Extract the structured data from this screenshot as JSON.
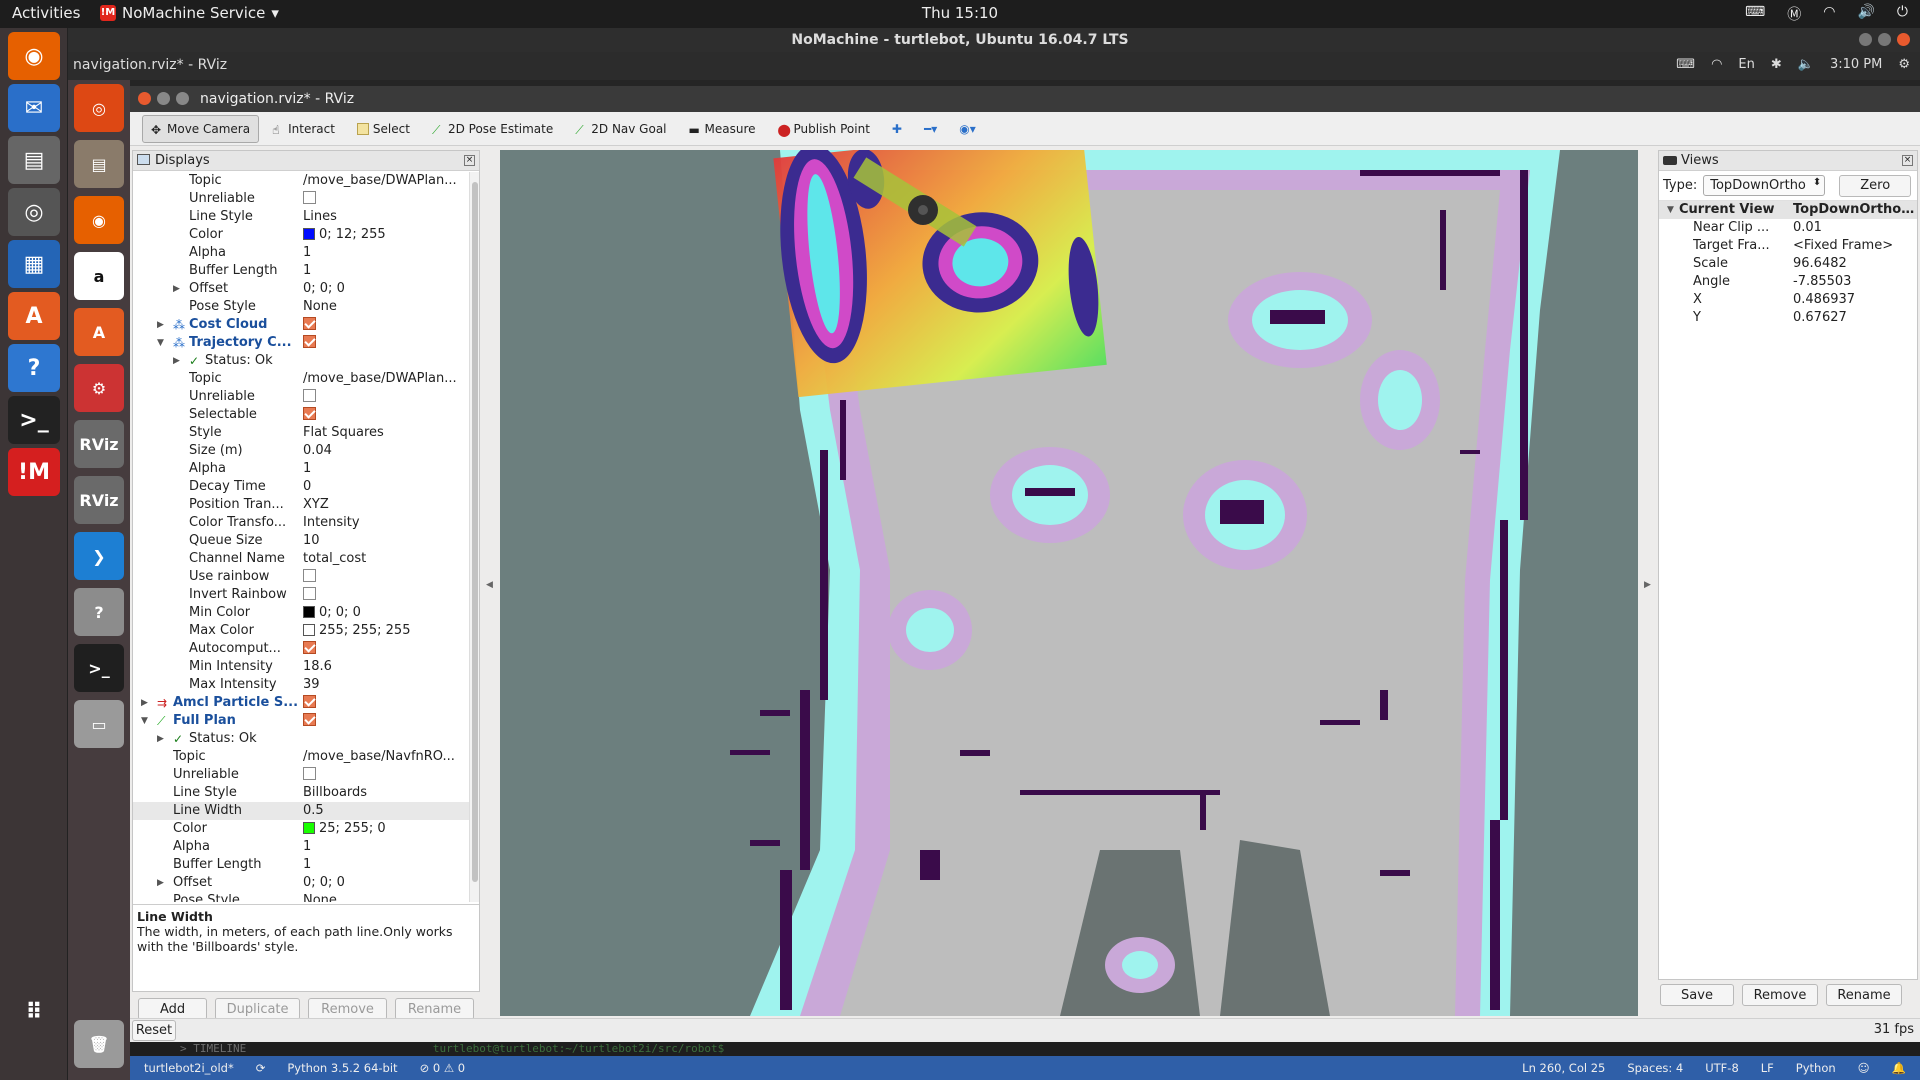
{
  "topbar": {
    "activities": "Activities",
    "app": "NoMachine Service",
    "clock": "Thu 15:10"
  },
  "nomachine_title": "NoMachine - turtlebot, Ubuntu 16.04.7 LTS",
  "inner_bar": {
    "title": "navigation.rviz* - RViz",
    "lang": "En",
    "time": "3:10 PM"
  },
  "rviz": {
    "title": "navigation.rviz* - RViz",
    "toolbar": [
      {
        "label": "Move Camera",
        "icon": "move-camera-icon"
      },
      {
        "label": "Interact",
        "icon": "interact-icon"
      },
      {
        "label": "Select",
        "icon": "select-icon"
      },
      {
        "label": "2D Pose Estimate",
        "icon": "pose-estimate-icon"
      },
      {
        "label": "2D Nav Goal",
        "icon": "nav-goal-icon"
      },
      {
        "label": "Measure",
        "icon": "measure-icon"
      },
      {
        "label": "Publish Point",
        "icon": "publish-point-icon"
      }
    ],
    "displays": {
      "title": "Displays",
      "rows": [
        {
          "key": "Topic",
          "value": "/move_base/DWAPlan...",
          "indent": 2
        },
        {
          "key": "Unreliable",
          "check": false,
          "indent": 2
        },
        {
          "key": "Line Style",
          "value": "Lines",
          "indent": 2
        },
        {
          "key": "Color",
          "value": "0; 12; 255",
          "swatch": "#000cff",
          "indent": 2
        },
        {
          "key": "Alpha",
          "value": "1",
          "indent": 2
        },
        {
          "key": "Buffer Length",
          "value": "1",
          "indent": 2
        },
        {
          "key": "Offset",
          "value": "0; 0; 0",
          "indent": 2,
          "arrow": "▶"
        },
        {
          "key": "Pose Style",
          "value": "None",
          "indent": 2
        },
        {
          "key": "Cost Cloud",
          "check": true,
          "indent": 1,
          "arrow": "▶",
          "group": true,
          "icon": "cloud"
        },
        {
          "key": "Trajectory C...",
          "check": true,
          "indent": 1,
          "arrow": "▼",
          "group": true,
          "icon": "cloud"
        },
        {
          "key": "Status: Ok",
          "indent": 2,
          "arrow": "▶",
          "status": true
        },
        {
          "key": "Topic",
          "value": "/move_base/DWAPlan...",
          "indent": 2
        },
        {
          "key": "Unreliable",
          "check": false,
          "indent": 2
        },
        {
          "key": "Selectable",
          "check": true,
          "indent": 2
        },
        {
          "key": "Style",
          "value": "Flat Squares",
          "indent": 2
        },
        {
          "key": "Size (m)",
          "value": "0.04",
          "indent": 2
        },
        {
          "key": "Alpha",
          "value": "1",
          "indent": 2
        },
        {
          "key": "Decay Time",
          "value": "0",
          "indent": 2
        },
        {
          "key": "Position Tran...",
          "value": "XYZ",
          "indent": 2
        },
        {
          "key": "Color Transfo...",
          "value": "Intensity",
          "indent": 2
        },
        {
          "key": "Queue Size",
          "value": "10",
          "indent": 2
        },
        {
          "key": "Channel Name",
          "value": "total_cost",
          "indent": 2
        },
        {
          "key": "Use rainbow",
          "check": false,
          "indent": 2
        },
        {
          "key": "Invert Rainbow",
          "check": false,
          "indent": 2
        },
        {
          "key": "Min Color",
          "value": "0; 0; 0",
          "swatch": "#000000",
          "indent": 2
        },
        {
          "key": "Max Color",
          "value": "255; 255; 255",
          "swatch": "#ffffff",
          "indent": 2
        },
        {
          "key": "Autocomput...",
          "check": true,
          "indent": 2
        },
        {
          "key": "Min Intensity",
          "value": "18.6",
          "indent": 2
        },
        {
          "key": "Max Intensity",
          "value": "39",
          "indent": 2
        },
        {
          "key": "Amcl Particle S...",
          "check": true,
          "indent": 0,
          "arrow": "▶",
          "group": true,
          "icon": "arrows"
        },
        {
          "key": "Full Plan",
          "check": true,
          "indent": 0,
          "arrow": "▼",
          "group": true,
          "icon": "path"
        },
        {
          "key": "Status: Ok",
          "indent": 1,
          "arrow": "▶",
          "status": true
        },
        {
          "key": "Topic",
          "value": "/move_base/NavfnRO...",
          "indent": 1
        },
        {
          "key": "Unreliable",
          "check": false,
          "indent": 1
        },
        {
          "key": "Line Style",
          "value": "Billboards",
          "indent": 1
        },
        {
          "key": "Line Width",
          "value": "0.5",
          "indent": 1,
          "selected": true
        },
        {
          "key": "Color",
          "value": "25; 255; 0",
          "swatch": "#19ff00",
          "indent": 1
        },
        {
          "key": "Alpha",
          "value": "1",
          "indent": 1
        },
        {
          "key": "Buffer Length",
          "value": "1",
          "indent": 1
        },
        {
          "key": "Offset",
          "value": "0; 0; 0",
          "indent": 1,
          "arrow": "▶"
        },
        {
          "key": "Pose Style",
          "value": "None",
          "indent": 1
        }
      ],
      "desc_title": "Line Width",
      "desc_text": "The width, in meters, of each path line.Only works with the 'Billboards' style.",
      "buttons": {
        "add": "Add",
        "duplicate": "Duplicate",
        "remove": "Remove",
        "rename": "Rename"
      }
    },
    "views": {
      "title": "Views",
      "type_label": "Type:",
      "type_value": "TopDownOrtho",
      "zero": "Zero",
      "current_view": "Current View",
      "current_view_type": "TopDownOrtho ...",
      "rows": [
        {
          "key": "Near Clip ...",
          "value": "0.01"
        },
        {
          "key": "Target Fra...",
          "value": "<Fixed Frame>"
        },
        {
          "key": "Scale",
          "value": "96.6482"
        },
        {
          "key": "Angle",
          "value": "-7.85503"
        },
        {
          "key": "X",
          "value": "0.486937"
        },
        {
          "key": "Y",
          "value": "0.67627"
        }
      ],
      "buttons": {
        "save": "Save",
        "remove": "Remove",
        "rename": "Rename"
      }
    },
    "reset": "Reset",
    "fps": "31 fps"
  },
  "terminal_strip": {
    "timeline": "> TIMELINE",
    "prompt": "turtlebot@turtlebot:~/turtlebot2i/src/robot$"
  },
  "statusbar": {
    "branch": "turtlebot2i_old*",
    "python": "Python 3.5.2 64-bit",
    "problems": "⊘ 0 ⚠ 0",
    "position": "Ln 260, Col 25",
    "spaces": "Spaces: 4",
    "encoding": "UTF-8",
    "eol": "LF",
    "language": "Python"
  },
  "colors": {
    "map_background": "#6c7f7e",
    "free_space": "#bdbdbd",
    "inflation": "#c9a8d8",
    "near_obstacle": "#9ff3ee",
    "obstacle": "#3a0b4a",
    "accent": "#e87a52"
  }
}
